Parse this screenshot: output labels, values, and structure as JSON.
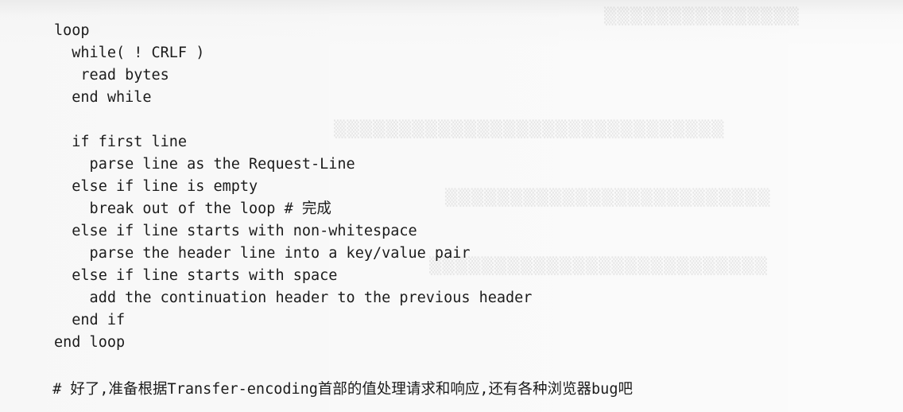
{
  "code_lines": [
    "loop",
    "  while( ! CRLF )",
    "   read bytes",
    "  end while",
    "",
    "  if first line",
    "    parse line as the Request-Line",
    "  else if line is empty",
    "    break out of the loop # 完成",
    "  else if line starts with non-whitespace",
    "    parse the header line into a key/value pair",
    "  else if line starts with space",
    "    add the continuation header to the previous header",
    "  end if",
    "end loop",
    "",
    " # 好了,准备根据Transfer-encoding首部的值处理请求和响应,还有各种浏览器bug吧"
  ]
}
